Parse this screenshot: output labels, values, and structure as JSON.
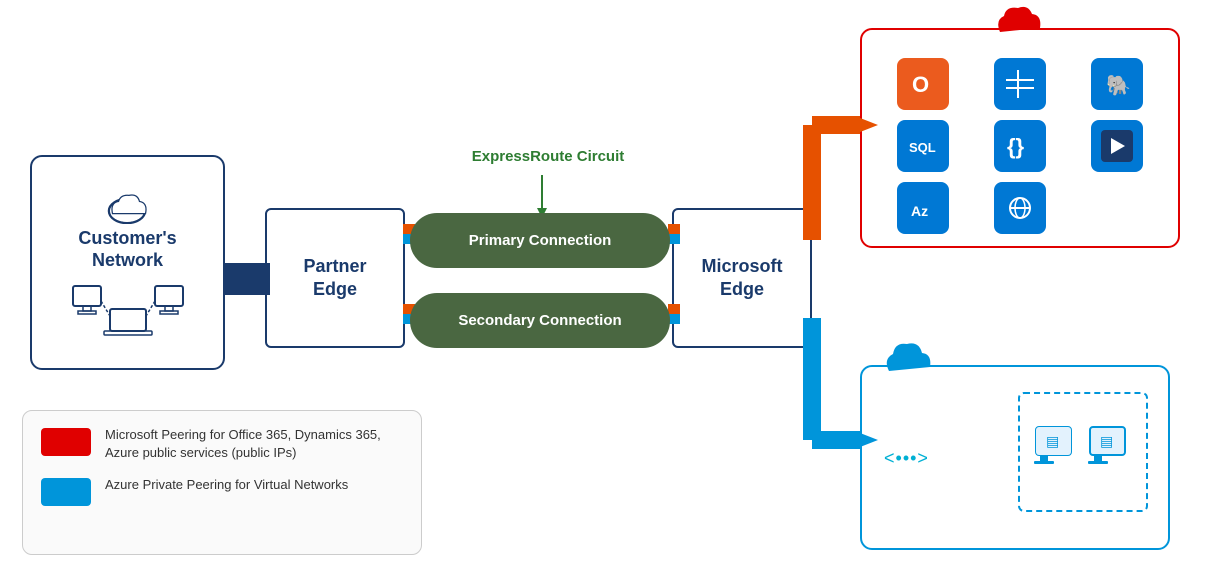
{
  "customer_network": {
    "label": "Customer's\nNetwork"
  },
  "partner_edge": {
    "label": "Partner\nEdge"
  },
  "microsoft_edge": {
    "label": "Microsoft\nEdge"
  },
  "expressroute": {
    "label": "ExpressRoute Circuit"
  },
  "primary_connection": {
    "label": "Primary Connection"
  },
  "secondary_connection": {
    "label": "Secondary Connection"
  },
  "legend": {
    "item1_text": "Microsoft Peering for Office 365, Dynamics 365, Azure public services (public IPs)",
    "item2_text": "Azure Private Peering for Virtual Networks"
  },
  "colors": {
    "dark_blue": "#1a3a6b",
    "green": "#4a6741",
    "orange": "#e65100",
    "light_blue": "#0095da",
    "red": "#e00000",
    "expressroute_green": "#2e7d32"
  }
}
